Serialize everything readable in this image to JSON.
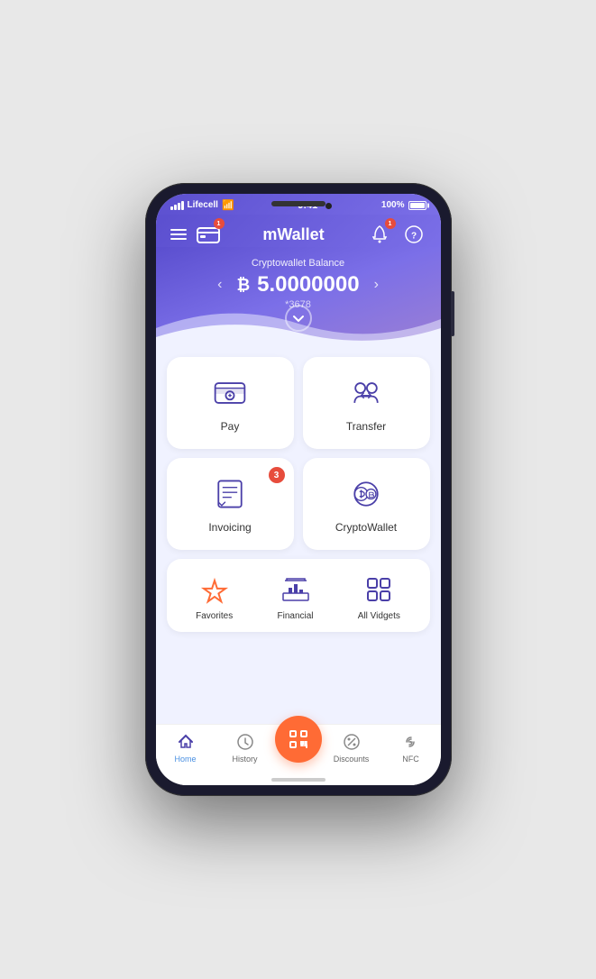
{
  "status_bar": {
    "carrier": "Lifecell",
    "time": "9:41",
    "battery_percent": "100%"
  },
  "header": {
    "title": "mWallet",
    "card_badge": "1",
    "notification_badge": "1"
  },
  "balance": {
    "label": "Cryptowallet Balance",
    "currency_symbol": "B",
    "amount": "5.0000000",
    "account_suffix": "*3678"
  },
  "actions": [
    {
      "id": "pay",
      "label": "Pay",
      "badge": null
    },
    {
      "id": "transfer",
      "label": "Transfer",
      "badge": null
    },
    {
      "id": "invoicing",
      "label": "Invoicing",
      "badge": "3"
    },
    {
      "id": "cryptowallet",
      "label": "CryptoWallet",
      "badge": null
    }
  ],
  "widgets": [
    {
      "id": "favorites",
      "label": "Favorites"
    },
    {
      "id": "financial",
      "label": "Financial"
    },
    {
      "id": "all-vidgets",
      "label": "All Vidgets"
    }
  ],
  "bottom_nav": [
    {
      "id": "home",
      "label": "Home",
      "active": true
    },
    {
      "id": "history",
      "label": "History",
      "active": false
    },
    {
      "id": "scan",
      "label": "",
      "active": false,
      "center": true
    },
    {
      "id": "discounts",
      "label": "Discounts",
      "active": false
    },
    {
      "id": "nfc",
      "label": "NFC",
      "active": false
    }
  ],
  "colors": {
    "primary": "#5b4fcf",
    "accent": "#ff6b35",
    "icon_color": "#4a3fa8"
  }
}
